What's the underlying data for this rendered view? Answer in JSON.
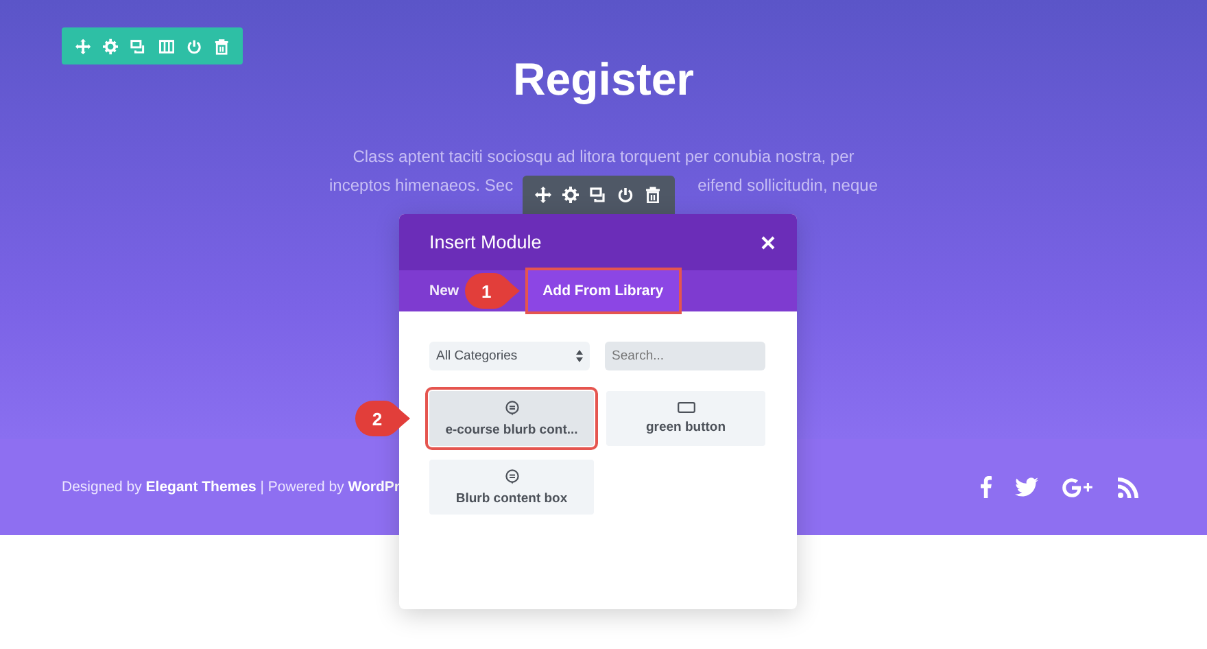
{
  "hero": {
    "title": "Register",
    "paragraph_lines": [
      {
        "parts": [
          "Class aptent taciti sociosqu ad litora torquent per conubia nostra, per"
        ]
      },
      {
        "parts": [
          "inceptos himenaeos. Sec",
          "eifend sollicitudin, neque"
        ]
      }
    ]
  },
  "footer": {
    "credit": "Designed by **Elegant Themes** | Powered by **WordPr**"
  },
  "modal": {
    "title": "Insert Module",
    "tabs": [
      {
        "label": "New",
        "selected": false
      },
      {
        "label": "Add From Library",
        "selected": true,
        "callout": "1"
      }
    ],
    "category_select": {
      "value": "All Categories"
    },
    "search": {
      "placeholder": "Search..."
    },
    "items": [
      {
        "label": "e-course blurb cont...",
        "kind": "blurb",
        "selected": true,
        "callout": "2"
      },
      {
        "label": "green button",
        "kind": "button",
        "selected": false
      },
      {
        "label": "Blurb content box",
        "kind": "blurb",
        "selected": false
      }
    ]
  }
}
